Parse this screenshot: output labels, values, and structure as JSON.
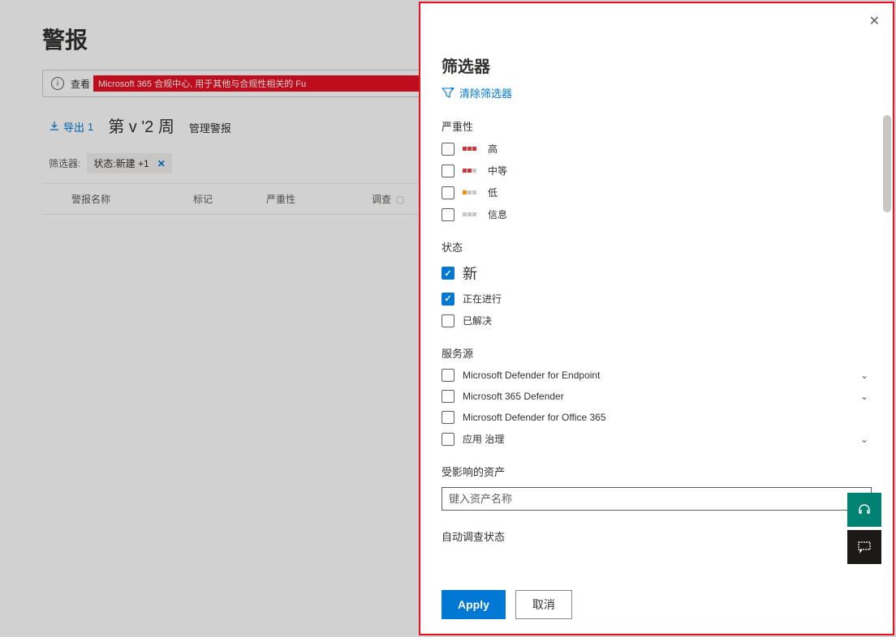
{
  "page_title": "警报",
  "banner": {
    "prefix": "查看",
    "link_text": "Microsoft 365 合规中心, 用于其他与合规性相关的 Fu"
  },
  "toolbar": {
    "export_label": "导出",
    "export_count": "1",
    "period_text": "第 v '2 周",
    "manage_label": "管理警报"
  },
  "filter_row": {
    "label": "筛选器:",
    "pill_text": "状态:新建 +1"
  },
  "table_headers": [
    "警报名称",
    "标记",
    "严重性",
    "调查"
  ],
  "panel": {
    "title": "筛选器",
    "clear_label": "清除筛选器",
    "severity": {
      "label": "严重性",
      "items": [
        "高",
        "中等",
        "低",
        "信息"
      ]
    },
    "status": {
      "label": "状态",
      "items": [
        {
          "label": "新",
          "checked": true,
          "big": true
        },
        {
          "label": "正在进行",
          "checked": true
        },
        {
          "label": "已解决",
          "checked": false
        }
      ]
    },
    "service": {
      "label": "服务源",
      "items": [
        {
          "label": "Microsoft Defender for Endpoint",
          "expandable": true
        },
        {
          "label": "Microsoft 365 Defender",
          "expandable": true
        },
        {
          "label": "Microsoft Defender for Office 365",
          "expandable": false
        },
        {
          "label": "应用 治理",
          "expandable": true
        }
      ]
    },
    "asset": {
      "label": "受影响的资产",
      "placeholder": "键入资产名称"
    },
    "auto_label": "自动调查状态",
    "apply_label": "Apply",
    "cancel_label": "取消"
  }
}
